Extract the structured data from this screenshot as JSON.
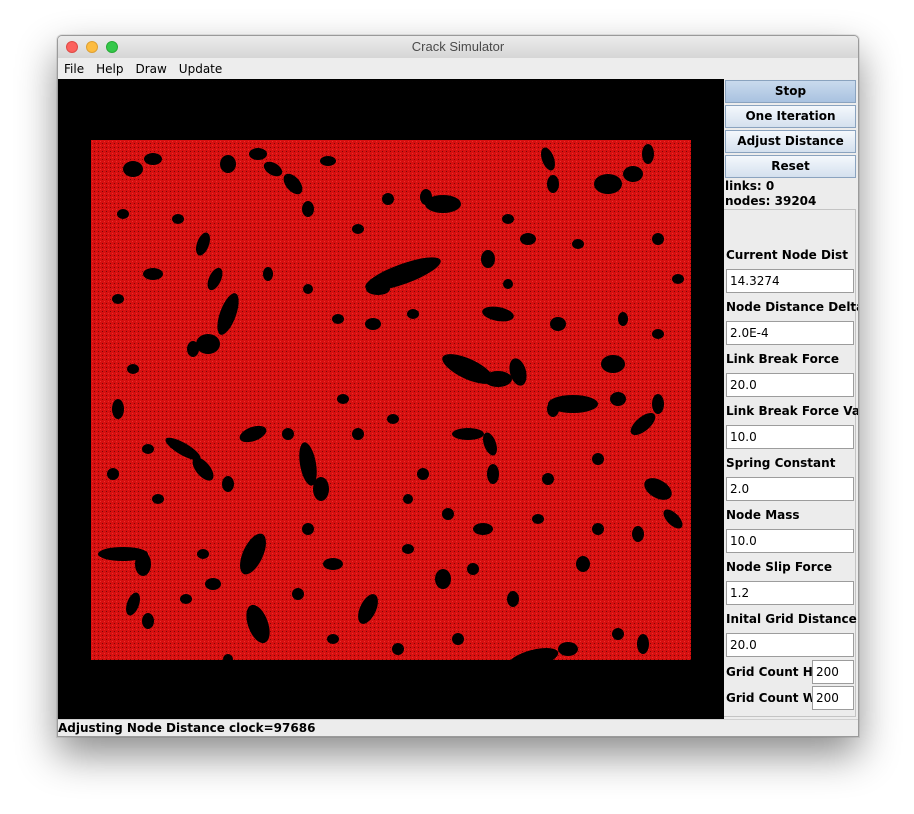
{
  "window": {
    "title": "Crack Simulator"
  },
  "menu": [
    "File",
    "Help",
    "Draw",
    "Update"
  ],
  "buttons": {
    "stop": "Stop",
    "one_iteration": "One Iteration",
    "adjust_distance": "Adjust Distance",
    "reset": "Reset"
  },
  "stats": {
    "links": "links: 0",
    "nodes": "nodes: 39204"
  },
  "params": {
    "current_node_dist": {
      "label": "Current Node Dist",
      "value": "14.3274"
    },
    "node_distance_delta": {
      "label": "Node Distance Delta",
      "value": "2.0E-4"
    },
    "link_break_force": {
      "label": "Link Break Force",
      "value": "20.0"
    },
    "link_break_force_var": {
      "label": "Link Break Force Var.",
      "value": "10.0"
    },
    "spring_constant": {
      "label": "Spring Constant",
      "value": "2.0"
    },
    "node_mass": {
      "label": "Node Mass",
      "value": "10.0"
    },
    "node_slip_force": {
      "label": "Node Slip Force",
      "value": "1.2"
    },
    "initial_grid_distance": {
      "label": "Inital Grid Distance",
      "value": "20.0"
    },
    "grid_count_h": {
      "label": "Grid Count H",
      "value": "200"
    },
    "grid_count_w": {
      "label": "Grid Count W",
      "value": "200"
    }
  },
  "status": {
    "text": "Adjusting Node Distance  clock=97686"
  },
  "colors": {
    "mesh": "#d61010",
    "background": "#000000",
    "crack": "#000000"
  }
}
